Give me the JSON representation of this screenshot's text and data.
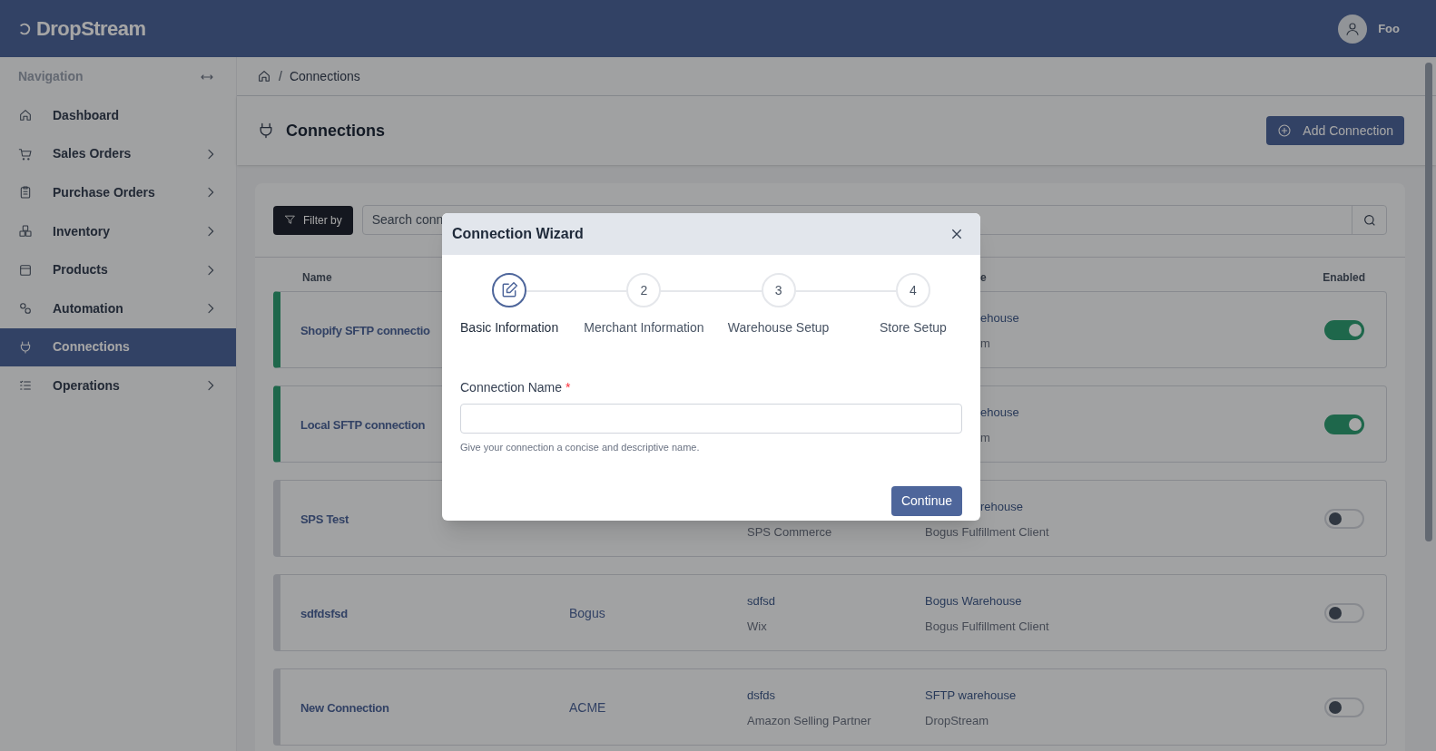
{
  "app": {
    "logo": "DropStream",
    "user": "Foo"
  },
  "sidebar": {
    "title": "Navigation",
    "items": [
      {
        "label": "Dashboard",
        "selected": false,
        "expandable": false
      },
      {
        "label": "Sales Orders",
        "selected": false,
        "expandable": true
      },
      {
        "label": "Purchase Orders",
        "selected": false,
        "expandable": true
      },
      {
        "label": "Inventory",
        "selected": false,
        "expandable": true
      },
      {
        "label": "Products",
        "selected": false,
        "expandable": true
      },
      {
        "label": "Automation",
        "selected": false,
        "expandable": true
      },
      {
        "label": "Connections",
        "selected": true,
        "expandable": false
      },
      {
        "label": "Operations",
        "selected": false,
        "expandable": true
      }
    ]
  },
  "breadcrumb": {
    "separator": "/",
    "current": "Connections"
  },
  "page": {
    "title": "Connections",
    "add_button": "Add Connection"
  },
  "filter": {
    "button": "Filter by",
    "search_placeholder": "Search conn"
  },
  "table": {
    "header": {
      "name": "Name",
      "warehouse": "e",
      "enabled": "Enabled"
    },
    "rows": [
      {
        "name": "Shopify SFTP connectio",
        "warehouse": [
          {
            "text": "ehouse",
            "clipped": true
          },
          {
            "text": "m",
            "clipped": true
          }
        ],
        "enabled": true
      },
      {
        "name": "Local SFTP connection",
        "warehouse": [
          {
            "text": "ehouse",
            "clipped": true
          },
          {
            "text": "m",
            "clipped": true
          }
        ],
        "enabled": true
      },
      {
        "name": "SPS Test",
        "store": [
          {
            "text": "SPS Commerce",
            "kind": "platform"
          }
        ],
        "warehouse": [
          {
            "text": "rehouse",
            "clipped": true
          },
          {
            "text": "Bogus Fulfillment Client",
            "clipped": false
          }
        ],
        "enabled": false
      },
      {
        "name": "sdfdsfsd",
        "merchant": "Bogus",
        "store": [
          {
            "text": "sdfsd",
            "kind": "name"
          },
          {
            "text": "Wix",
            "kind": "platform"
          }
        ],
        "warehouse": [
          {
            "text": "Bogus Warehouse",
            "clipped": false
          },
          {
            "text": "Bogus Fulfillment Client",
            "clipped": false
          }
        ],
        "enabled": false
      },
      {
        "name": "New Connection",
        "merchant": "ACME",
        "store": [
          {
            "text": "dsfds",
            "kind": "name"
          },
          {
            "text": "Amazon Selling Partner",
            "kind": "platform"
          }
        ],
        "warehouse": [
          {
            "text": "SFTP warehouse",
            "clipped": false
          },
          {
            "text": "DropStream",
            "clipped": false
          }
        ],
        "enabled": false
      }
    ]
  },
  "modal": {
    "title": "Connection Wizard",
    "steps": [
      {
        "label": "Basic Information",
        "selected": true
      },
      {
        "number": "2",
        "label": "Merchant Information",
        "selected": false
      },
      {
        "number": "3",
        "label": "Warehouse Setup",
        "selected": false
      },
      {
        "number": "4",
        "label": "Store Setup",
        "selected": false
      }
    ],
    "field": {
      "label": "Connection Name",
      "required_mark": "*",
      "help": "Give your connection a concise and descriptive name."
    },
    "continue_button": "Continue"
  }
}
